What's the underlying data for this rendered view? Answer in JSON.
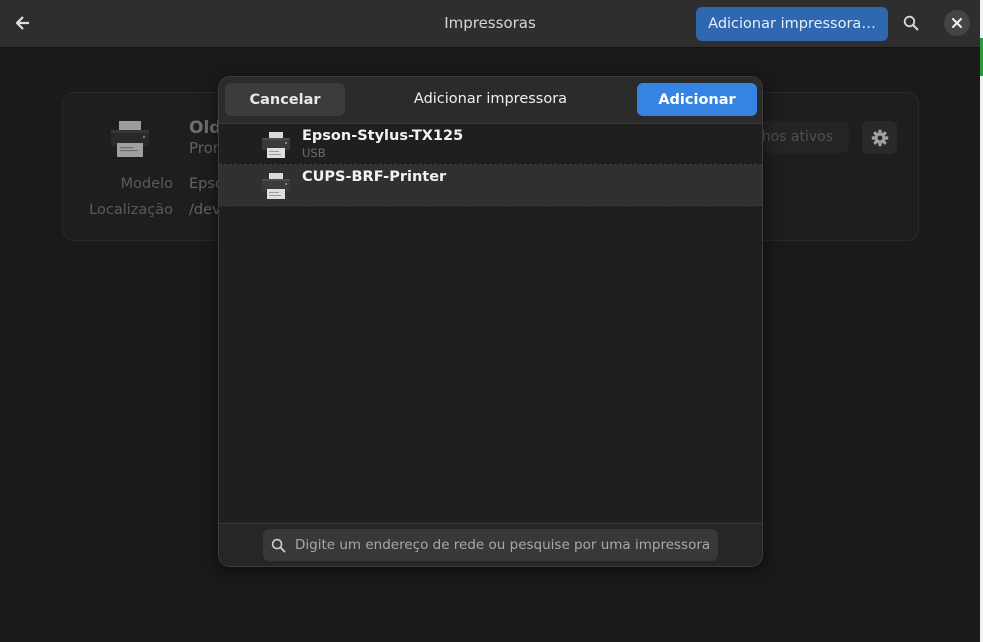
{
  "window": {
    "title": "Impressoras"
  },
  "header": {
    "add_printer_label": "Adicionar impressora…"
  },
  "printer_card": {
    "name": "Old",
    "state": "Pron",
    "model_label": "Modelo",
    "model_value": "Epsc",
    "location_label": "Localização",
    "location_value": "/dev",
    "jobs_button": "lhos ativos"
  },
  "dialog": {
    "title": "Adicionar impressora",
    "cancel_label": "Cancelar",
    "add_label": "Adicionar",
    "printers": [
      {
        "name": "Epson-Stylus-TX125",
        "connection": "USB"
      },
      {
        "name": "CUPS-BRF-Printer",
        "connection": ""
      }
    ],
    "search": {
      "placeholder": "Digite um endereço de rede ou pesquise por uma impressora",
      "value": ""
    }
  },
  "colors": {
    "accent": "#3584e4",
    "header_button": "#2f67b1",
    "background": "#242424"
  },
  "icons": [
    "back-arrow-icon",
    "search-icon",
    "close-icon",
    "printer-icon",
    "gear-icon"
  ]
}
